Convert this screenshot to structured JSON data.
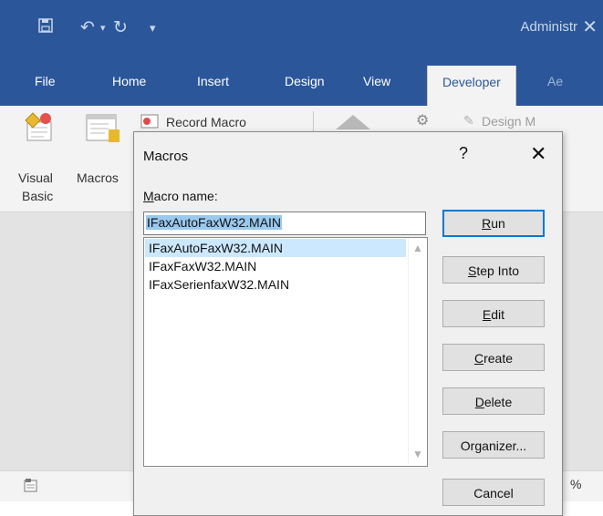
{
  "window": {
    "title": "Administr",
    "close_glyph": "✕"
  },
  "qat": {
    "save_icon": "save-icon",
    "undo_icon": "undo-icon",
    "redo_icon": "redo-icon",
    "customize_icon": "customize-qat-icon"
  },
  "tabs": [
    "File",
    "Home",
    "Insert",
    "Design",
    "View",
    "Developer",
    "Ae"
  ],
  "active_tab": "Developer",
  "ribbon": {
    "visual_basic_line1": "Visual",
    "visual_basic_line2": "Basic",
    "macros_label": "Macros",
    "record_macro": "Record Macro",
    "design_mode": "Design M",
    "collapse_glyph": "⌃"
  },
  "status": {
    "zoom_fragment": "%"
  },
  "dialog": {
    "title": "Macros",
    "help_glyph": "?",
    "close_glyph": "✕",
    "macro_name_label_prefix": "M",
    "macro_name_label_rest": "acro name:",
    "macro_name_value": "IFaxAutoFaxW32.MAIN",
    "macros": [
      "IFaxAutoFaxW32.MAIN",
      "IFaxFaxW32.MAIN",
      "IFaxSerienfaxW32.MAIN"
    ],
    "selected_index": 0,
    "buttons": {
      "run_a": "",
      "run_u": "R",
      "run_b": "un",
      "step_a": "",
      "step_u": "S",
      "step_b": "tep Into",
      "edit_a": "",
      "edit_u": "E",
      "edit_b": "dit",
      "create_a": "",
      "create_u": "C",
      "create_b": "reate",
      "delete_a": "",
      "delete_u": "D",
      "delete_b": "elete",
      "org_a": "Or",
      "org_u": "g",
      "org_b": "anizer...",
      "cancel": "Cancel"
    }
  }
}
